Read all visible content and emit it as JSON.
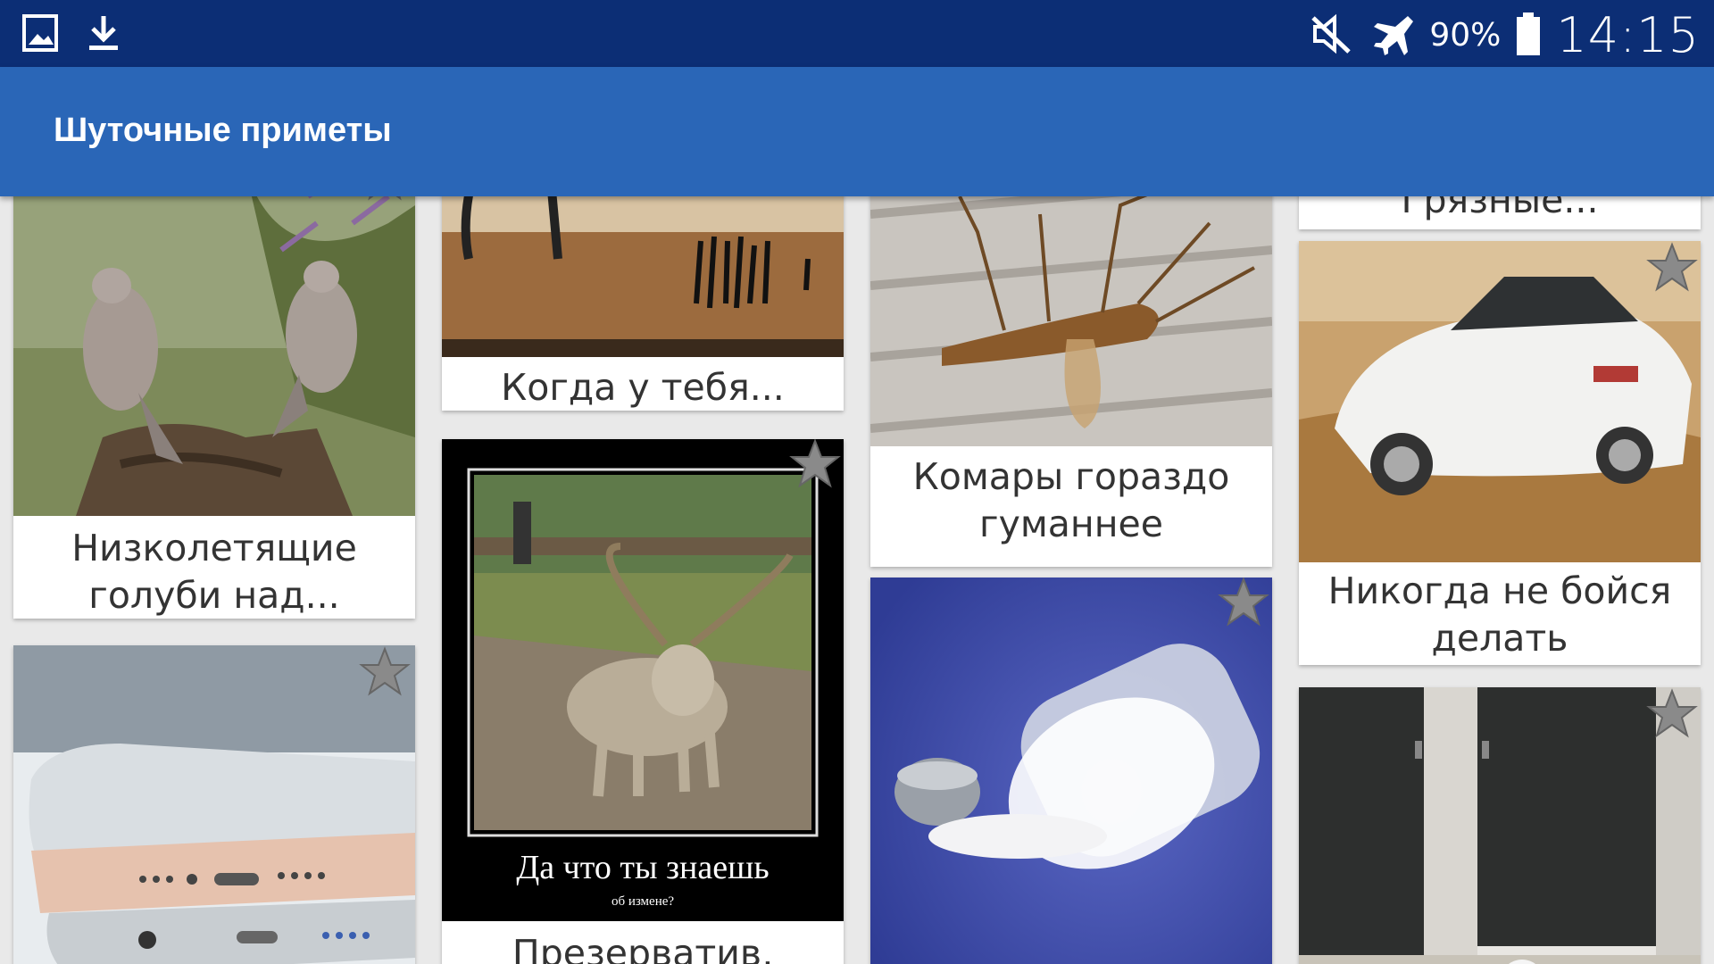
{
  "status_bar": {
    "battery": "90%",
    "time": "14:15",
    "icons": [
      "gallery-icon",
      "download-icon",
      "mute-icon",
      "airplane-mode-icon",
      "battery-icon"
    ]
  },
  "app_bar": {
    "title": "Шуточные приметы"
  },
  "cards": [
    {
      "caption": "Низколетящие голуби над...",
      "image": "two-doves-on-branch",
      "favorite": false
    },
    {
      "caption": "",
      "image": "smartphones-closeup",
      "favorite": false
    },
    {
      "caption": "Когда у тебя...",
      "image": "nails-on-wood",
      "favorite": false
    },
    {
      "caption": "Презерватив,",
      "image": "demotivator-goat",
      "favorite": false,
      "image_text": {
        "title": "Да что ты знаешь",
        "subtitle": "об измене?"
      }
    },
    {
      "caption": "Комары гораздо гуманнее",
      "image": "mosquito-macro",
      "favorite": false
    },
    {
      "caption": "",
      "image": "spilled-salt-shaker",
      "favorite": false
    },
    {
      "caption": "Грязные...",
      "image": "",
      "favorite": false
    },
    {
      "caption": "Никогда не бойся делать",
      "image": "white-car-drifting",
      "favorite": false
    },
    {
      "caption": "",
      "image": "restroom-stalls",
      "favorite": false
    }
  ],
  "colors": {
    "status_bar": "#0c2e75",
    "app_bar": "#2a66b7",
    "background": "#e9e9e9",
    "star": "#8a8a8a"
  }
}
